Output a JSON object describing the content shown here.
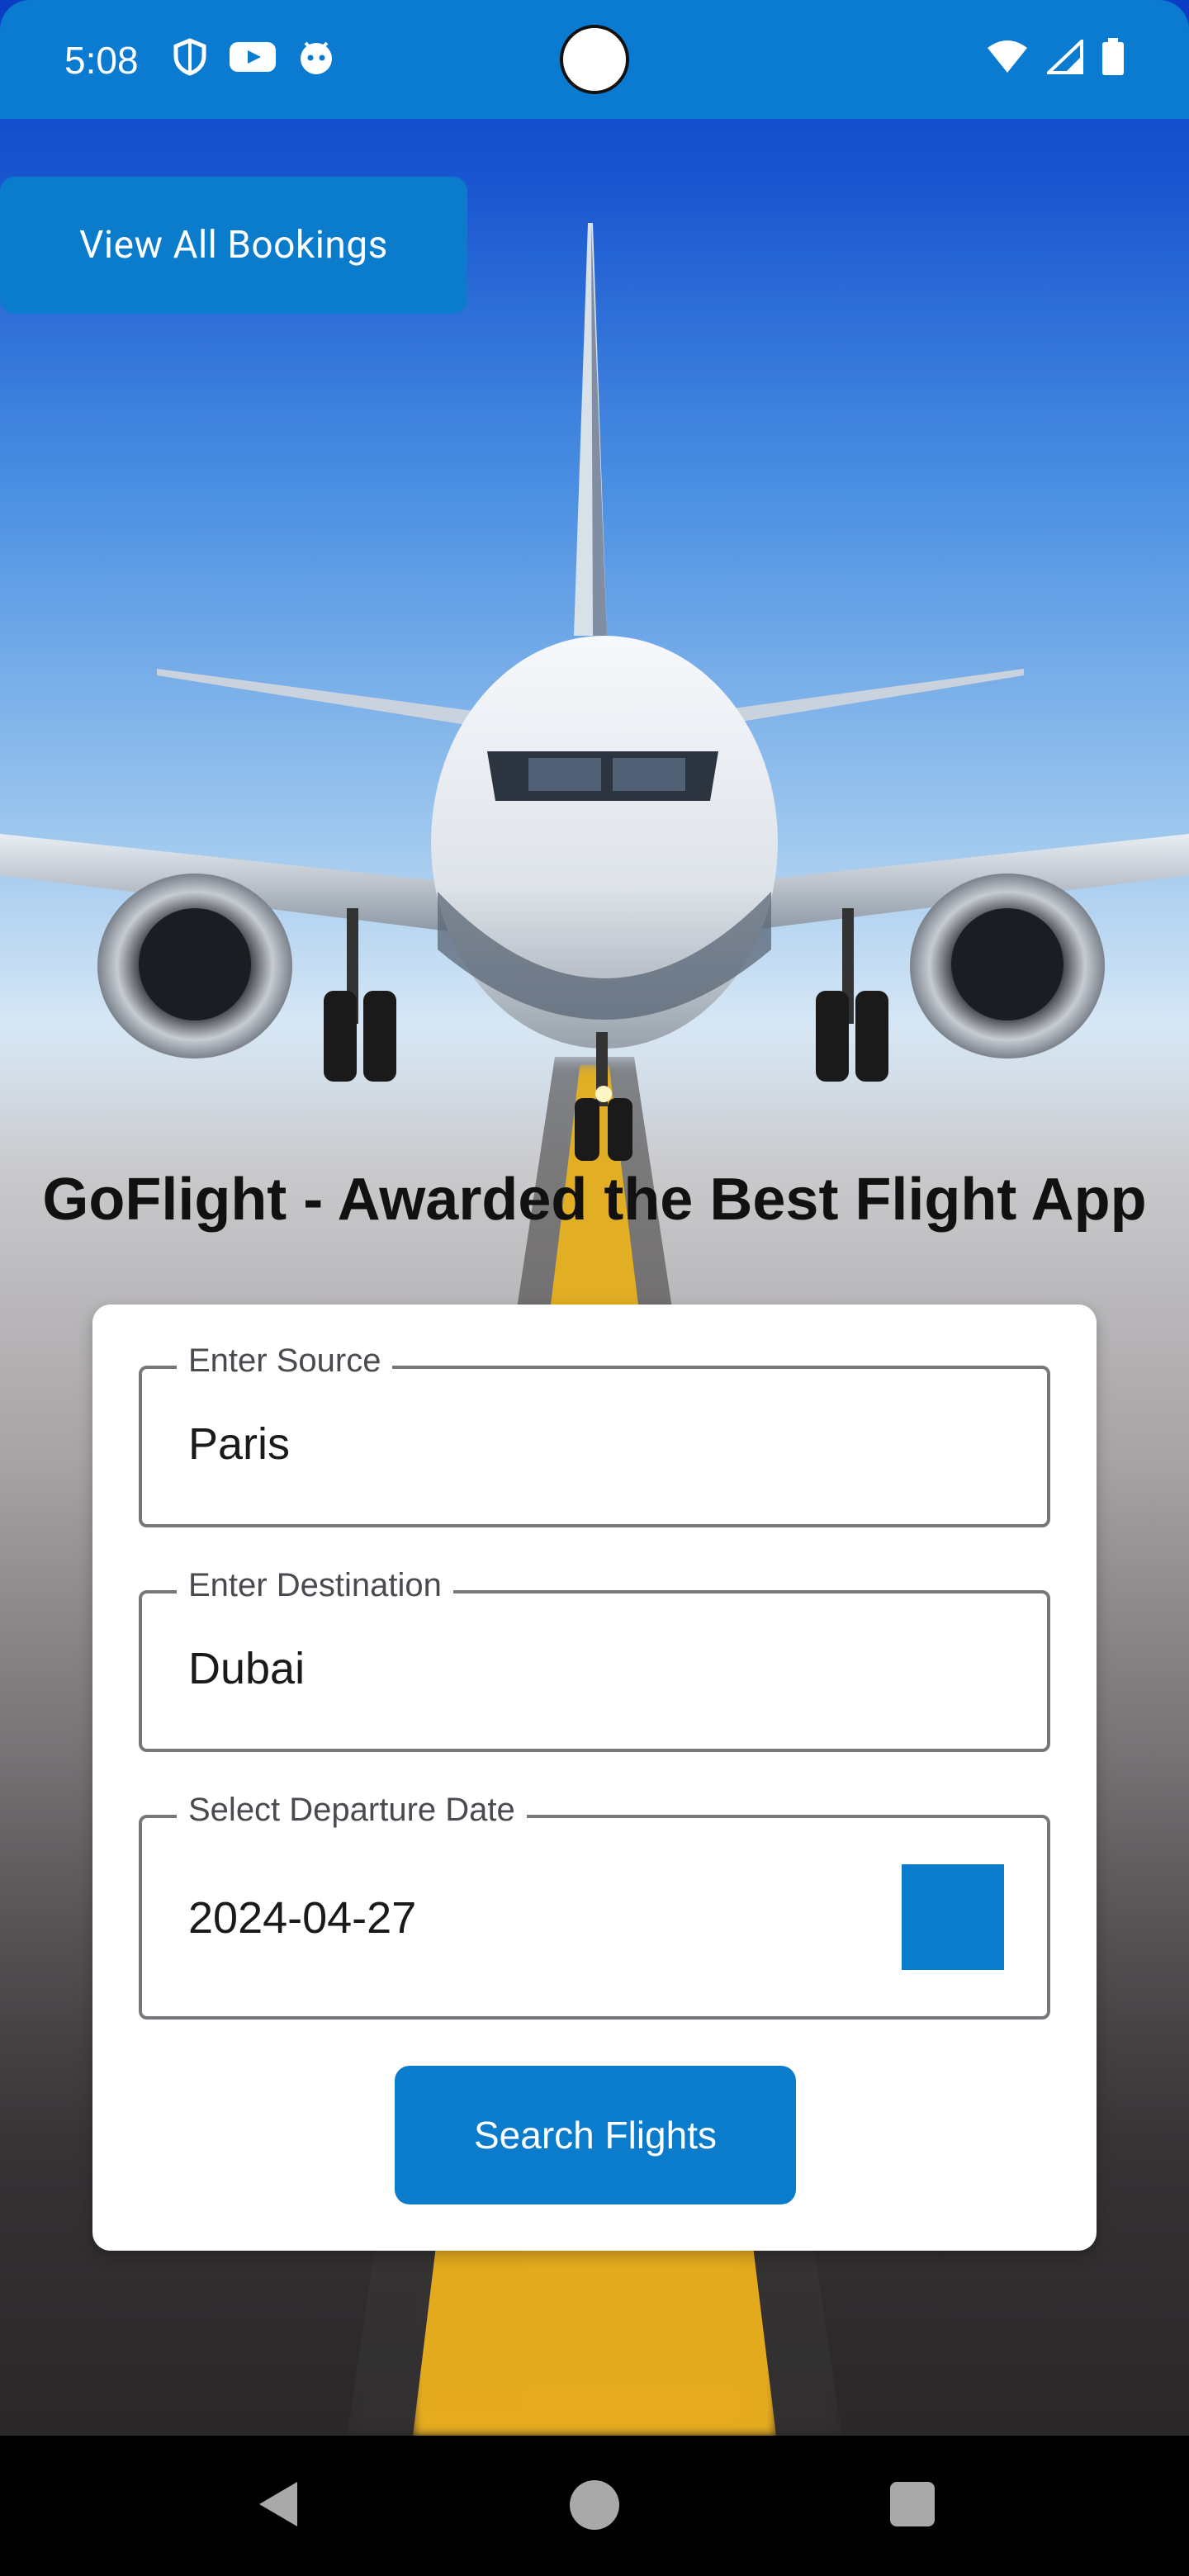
{
  "status_bar": {
    "time": "5:08",
    "left_icons": [
      "shield-icon",
      "youtube-icon",
      "android-face-icon"
    ],
    "right_icons": [
      "wifi-icon",
      "cell-signal-icon",
      "battery-icon"
    ],
    "accent_color": "#0a7bd0"
  },
  "header": {
    "view_bookings_label": "View All Bookings"
  },
  "hero": {
    "title": "GoFlight - Awarded the Best Flight App"
  },
  "form": {
    "source": {
      "label": "Enter Source",
      "value": "Paris"
    },
    "destination": {
      "label": "Enter Destination",
      "value": "Dubai"
    },
    "date": {
      "label": "Select Departure Date",
      "value": "2024-04-27"
    },
    "search_label": "Search Flights"
  },
  "navbar": {
    "icons": [
      "back-icon",
      "home-icon",
      "recents-icon"
    ]
  },
  "theme": {
    "primary": "#0b7ccc",
    "card_bg": "#ffffff",
    "text_dark": "#111111"
  }
}
